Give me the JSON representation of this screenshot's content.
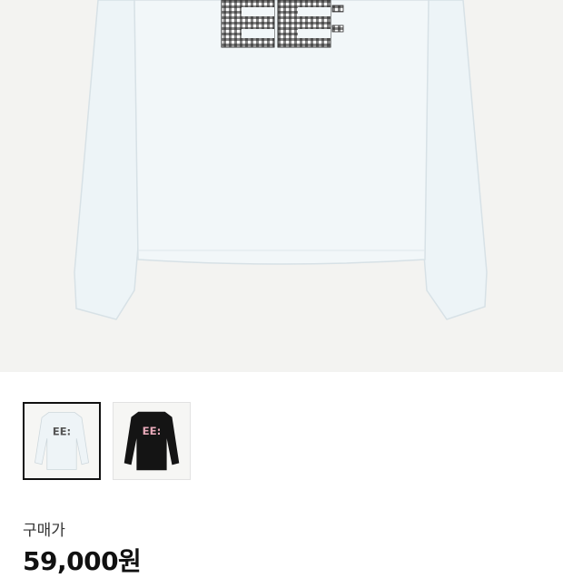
{
  "product": {
    "image_alt": "white long sleeve tee with gingham EE logo",
    "selected_thumbnail": 0,
    "thumbnails": [
      {
        "name": "white-tee-thumbnail",
        "body_color": "#eef4f7",
        "logo_color": "#555555"
      },
      {
        "name": "black-tee-thumbnail",
        "body_color": "#141414",
        "logo_color": "#e7a9b8"
      }
    ]
  },
  "pricing": {
    "label": "구매가",
    "price": "59,000원"
  },
  "colors": {
    "hero_background": "#f3f3f1",
    "tee_body": "#edf4f7",
    "tee_shadow": "#d7e1e6",
    "gingham_dark": "#1e1e1e"
  }
}
